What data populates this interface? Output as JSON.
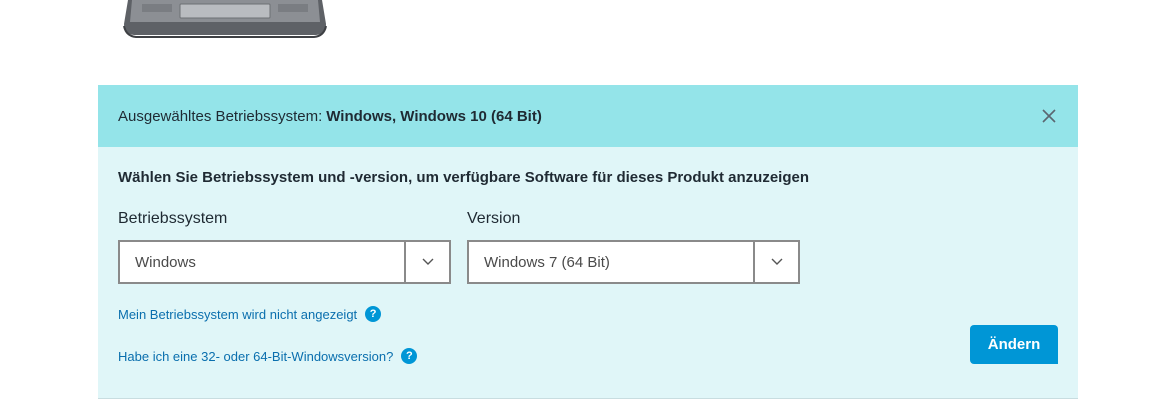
{
  "header": {
    "prefix": "Ausgewähltes Betriebssystem:",
    "selected_os": "Windows, Windows 10 (64 Bit)"
  },
  "instruction": "Wählen Sie Betriebssystem und -version, um verfügbare Software für dieses Produkt anzuzeigen",
  "os_select": {
    "label": "Betriebssystem",
    "value": "Windows"
  },
  "version_select": {
    "label": "Version",
    "value": "Windows 7 (64 Bit)"
  },
  "links": {
    "os_not_listed": "Mein Betriebssystem wird nicht angezeigt",
    "bit_version": "Habe ich eine 32- oder 64-Bit-Windowsversion?",
    "help_glyph": "?"
  },
  "change_button": "Ändern",
  "colors": {
    "header_bg": "#94e4e9",
    "panel_bg": "#e0f6f8",
    "accent": "#0096d6",
    "link": "#0a6fae"
  },
  "icons": [
    "laptop-image",
    "close-icon",
    "chevron-down-icon",
    "help-icon"
  ]
}
